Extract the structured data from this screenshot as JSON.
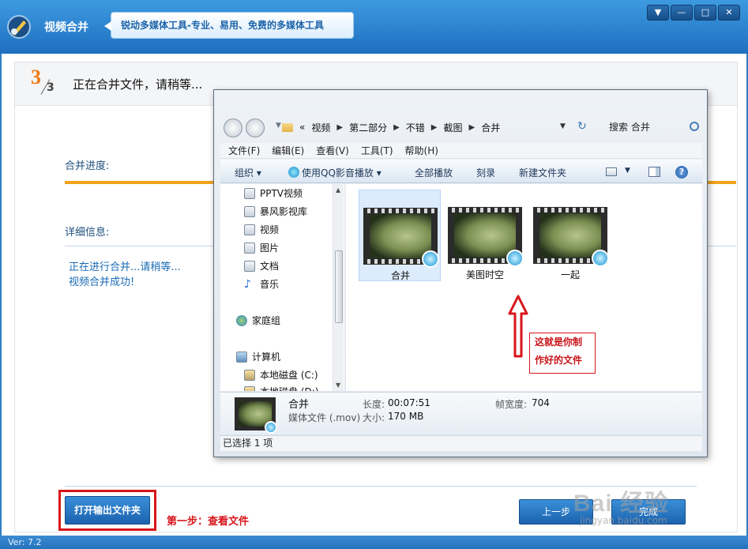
{
  "app": {
    "title": "视频合并",
    "slogan": "锐动多媒体工具-专业、易用、免费的多媒体工具",
    "window_buttons": {
      "dropdown": "▼",
      "minimize": "—",
      "maximize": "□",
      "close": "✕"
    },
    "version": "Ver: 7.2"
  },
  "step": {
    "current": "3",
    "total": "3",
    "text": "正在合并文件，请稍等..."
  },
  "merge": {
    "progress_label": "合并进度:",
    "progress_fraction": 1.0,
    "detail_label": "详细信息:",
    "log": [
      "正在进行合并...请稍等...",
      "视频合并成功!"
    ]
  },
  "footer": {
    "open_output_folder": "打开输出文件夹",
    "step1_hint": "第一步：查看文件",
    "prev_button": "上一步",
    "done_button": "完成"
  },
  "watermark": {
    "brand": "Bai 经验",
    "sub": "jingyan.baidu.com"
  },
  "explorer": {
    "breadcrumb": [
      "«",
      "视频",
      "第二部分",
      "不错",
      "截图",
      "合并"
    ],
    "search_placeholder": "搜索 合并",
    "menu": [
      "文件(F)",
      "编辑(E)",
      "查看(V)",
      "工具(T)",
      "帮助(H)"
    ],
    "toolbar": {
      "organize": "组织 ▾",
      "play_qq": "使用QQ影音播放 ▾",
      "play_all": "全部播放",
      "burn": "刻录",
      "new_folder": "新建文件夹"
    },
    "nav_items": [
      {
        "label": "PPTV视频",
        "icon": "library-icon"
      },
      {
        "label": "暴风影视库",
        "icon": "library-icon"
      },
      {
        "label": "视频",
        "icon": "video-library-icon"
      },
      {
        "label": "图片",
        "icon": "picture-library-icon"
      },
      {
        "label": "文档",
        "icon": "document-library-icon"
      },
      {
        "label": "音乐",
        "icon": "music-icon"
      },
      {
        "label": "家庭组",
        "icon": "homegroup-icon"
      },
      {
        "label": "计算机",
        "icon": "computer-icon"
      },
      {
        "label": "本地磁盘 (C:)",
        "icon": "disk-icon"
      },
      {
        "label": "本地磁盘 (D:)",
        "icon": "disk-icon"
      }
    ],
    "files": [
      {
        "name": "合并",
        "selected": true
      },
      {
        "name": "美图时空",
        "selected": false
      },
      {
        "name": "一起",
        "selected": false
      }
    ],
    "callout": [
      "这就是你制",
      "作好的文件"
    ],
    "details": {
      "name": "合并",
      "type": "媒体文件 (.mov)",
      "length_label": "长度:",
      "length": "00:07:51",
      "size_label": "大小:",
      "size": "170 MB",
      "width_label": "帧宽度:",
      "width": "704"
    },
    "status": "已选择 1 项"
  },
  "colors": {
    "accent_blue": "#2f7fc4",
    "step_orange": "#f07a14",
    "progress_orange": "#f2a31a",
    "callout_red": "#d8151b",
    "log_blue": "#1a6bb5"
  }
}
